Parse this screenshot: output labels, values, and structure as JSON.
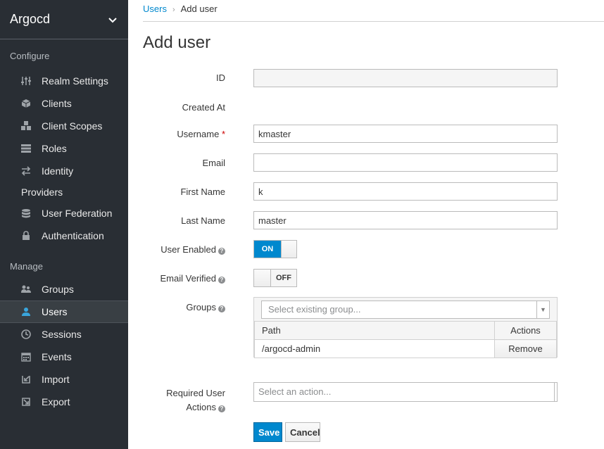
{
  "sidebar": {
    "realm": "Argocd",
    "configure_title": "Configure",
    "configure_items": {
      "realm_settings": "Realm Settings",
      "clients": "Clients",
      "client_scopes": "Client Scopes",
      "roles": "Roles",
      "identity_line1": "Identity",
      "identity_line2": "Providers",
      "user_federation": "User Federation",
      "authentication": "Authentication"
    },
    "manage_title": "Manage",
    "manage_items": {
      "groups": "Groups",
      "users": "Users",
      "sessions": "Sessions",
      "events": "Events",
      "import": "Import",
      "export": "Export"
    }
  },
  "breadcrumb": {
    "parent": "Users",
    "current": "Add user"
  },
  "page_title": "Add user",
  "form": {
    "id_label": "ID",
    "id_value": "",
    "created_at_label": "Created At",
    "username_label": "Username",
    "username_required": "*",
    "username_value": "kmaster",
    "email_label": "Email",
    "email_value": "",
    "first_name_label": "First Name",
    "first_name_value": "k",
    "last_name_label": "Last Name",
    "last_name_value": "master",
    "user_enabled_label": "User Enabled",
    "user_enabled_state": "ON",
    "email_verified_label": "Email Verified",
    "email_verified_state": "OFF",
    "groups_label": "Groups",
    "groups_placeholder": "Select existing group...",
    "groups_table": {
      "col_path": "Path",
      "col_actions": "Actions",
      "rows": [
        {
          "path": "/argocd-admin",
          "action": "Remove"
        }
      ]
    },
    "required_actions_label_line1": "Required User",
    "required_actions_label_line2": "Actions",
    "required_actions_placeholder": "Select an action...",
    "help_glyph": "?"
  },
  "buttons": {
    "save": "Save",
    "cancel": "Cancel"
  },
  "colors": {
    "sidebar_bg": "#292e34",
    "accent": "#0088ce",
    "active_icon": "#39a5dc"
  }
}
